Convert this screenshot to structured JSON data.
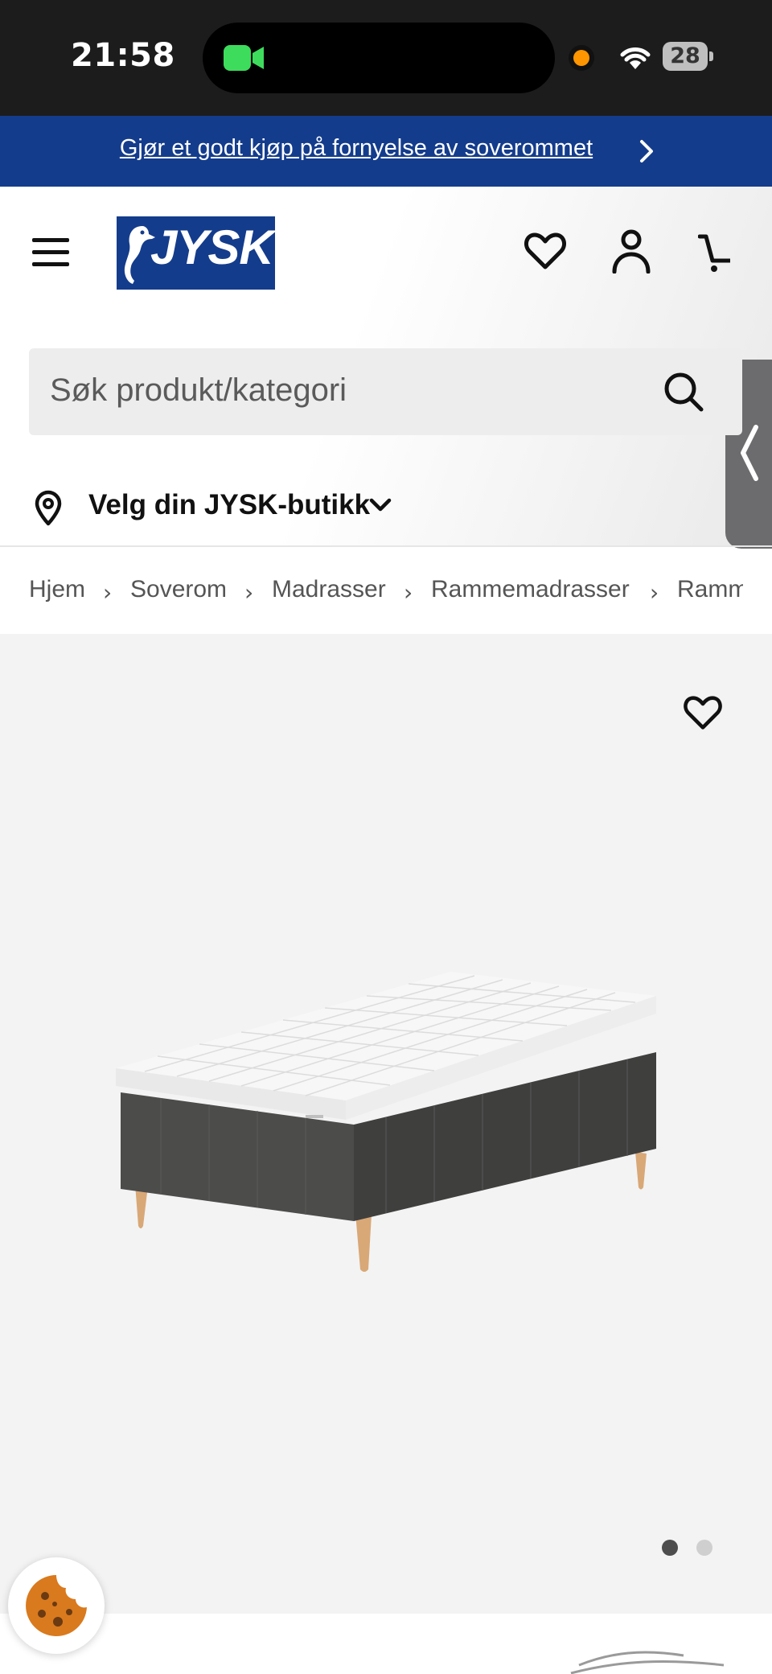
{
  "status_bar": {
    "time": "21:58",
    "battery": "28"
  },
  "promo": {
    "text": "Gjør et godt kjøp på fornyelse av soverommet"
  },
  "header": {
    "logo_text": "JYSK"
  },
  "search": {
    "placeholder": "Søk produkt/kategori"
  },
  "store": {
    "label": "Velg din JYSK-butikk"
  },
  "breadcrumb": {
    "items": [
      "Hjem",
      "Soverom",
      "Madrasser",
      "Rammemadrasser",
      "Ramm"
    ]
  },
  "gallery": {
    "image_count": 2,
    "active_index": 1
  },
  "colors": {
    "brand_blue": "#143c8c",
    "status_bg": "#1c1c1c",
    "gallery_bg": "#f3f3f3"
  }
}
